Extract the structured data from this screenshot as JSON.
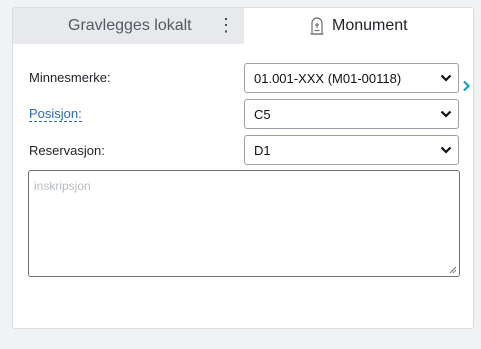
{
  "tabs": {
    "inactive_label": "Gravlegges lokalt",
    "active_label": "Monument",
    "menu_icon": "kebab-menu-icon",
    "monument_icon": "gravestone-icon"
  },
  "form": {
    "minnesmerke": {
      "label": "Minnesmerke:",
      "value": "01.001-XXX (M01-00118)"
    },
    "posisjon": {
      "label": "Posisjon:",
      "value": "C5"
    },
    "reservasjon": {
      "label": "Reservasjon:",
      "value": "D1"
    },
    "inskripsjon": {
      "placeholder": "inskripsjon",
      "value": ""
    }
  },
  "colors": {
    "accent": "#1a9bc7",
    "link": "#2a6bb5",
    "inactive_tab": "#e8e9ec"
  }
}
